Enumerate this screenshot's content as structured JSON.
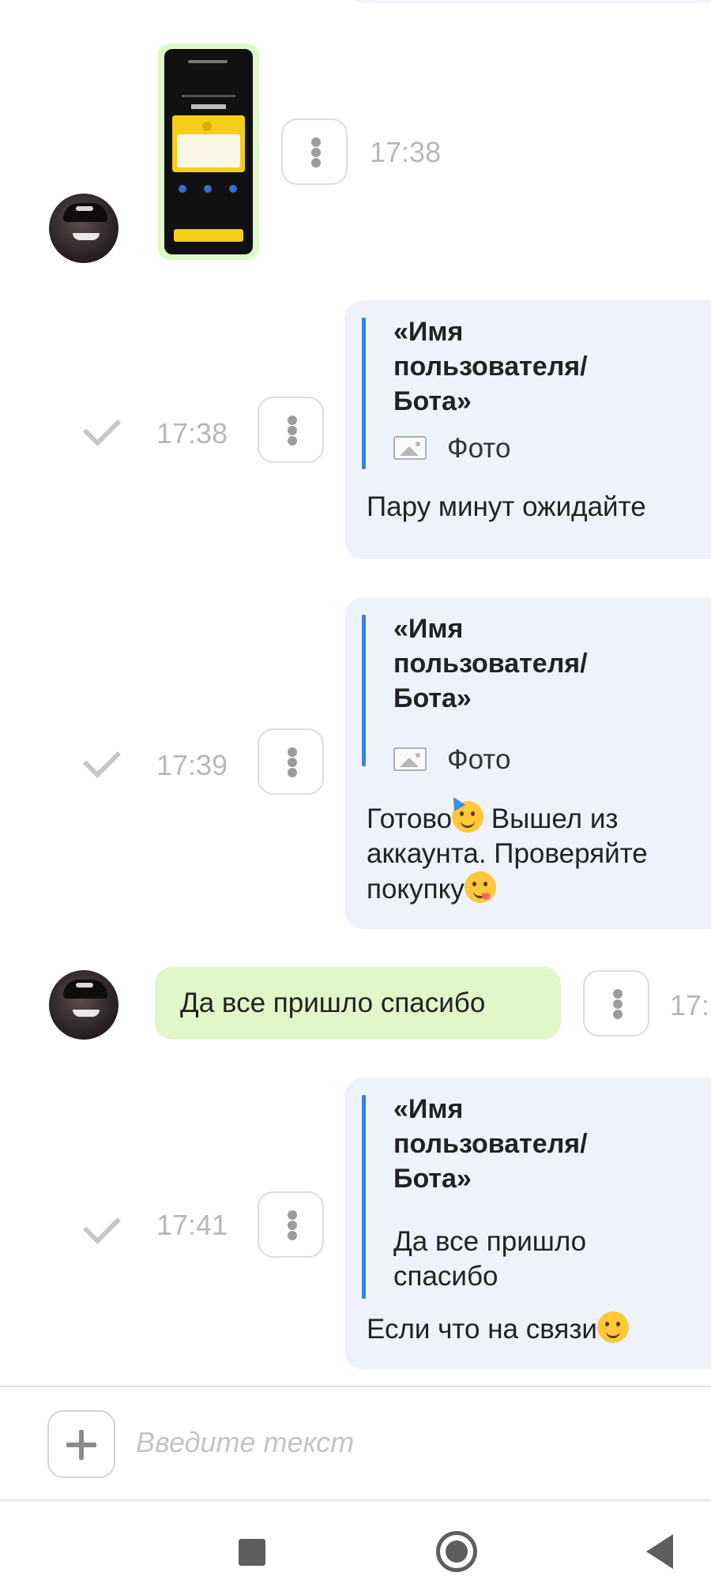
{
  "chat": {
    "messages": [
      {
        "type": "incoming-photo",
        "time": "17:38"
      },
      {
        "type": "outgoing",
        "time": "17:38",
        "quote_author": "«Имя пользователя/ Бота»",
        "quote_text": "Фото",
        "text": "Пару минут ожидайте"
      },
      {
        "type": "outgoing",
        "time": "17:39",
        "quote_author": "«Имя пользователя/ Бота»",
        "quote_text": "Фото",
        "text_line1_a": "Готово",
        "text_line1_b": " Вышел из",
        "text_line2": "аккаунта. Проверяйте",
        "text_line3": "покупку"
      },
      {
        "type": "incoming",
        "time": "17:",
        "text": "Да все пришло спасибо"
      },
      {
        "type": "outgoing",
        "time": "17:41",
        "quote_author": "«Имя пользователя/ Бота»",
        "quote_text": "Да все пришло спасибо",
        "text": "Если что на связи"
      }
    ]
  },
  "composer": {
    "placeholder": "Введите текст"
  },
  "icons": {
    "menu": "vertical-dots-icon",
    "sent": "check-icon",
    "attach": "plus-icon",
    "photo": "image-icon",
    "emoji_party": "party-face-emoji",
    "emoji_yum": "yum-face-emoji",
    "emoji_wink": "wink-face-emoji"
  },
  "colors": {
    "outgoing_bubble": "#eef3fb",
    "incoming_bubble": "#e0f7c8",
    "quote_accent": "#3b7ee8",
    "timestamp": "#b8b8b8"
  }
}
